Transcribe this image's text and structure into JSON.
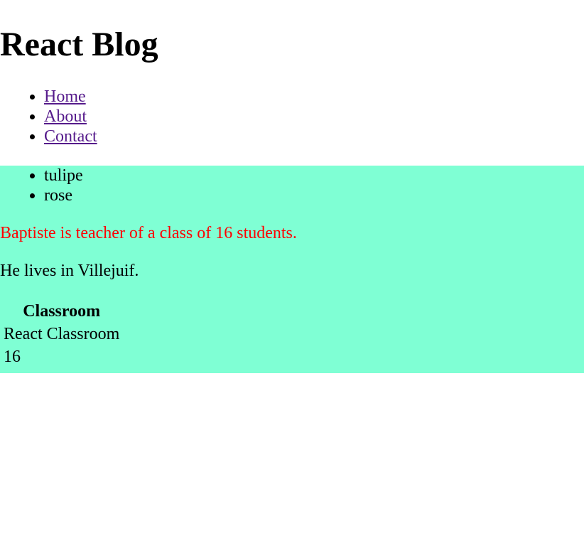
{
  "header": {
    "title": "React Blog"
  },
  "nav": {
    "items": [
      {
        "label": "Home"
      },
      {
        "label": "About"
      },
      {
        "label": "Contact"
      }
    ]
  },
  "content": {
    "background_color": "#7fffd4",
    "flowers": [
      "tulipe",
      "rose"
    ],
    "teacher_sentence": "Baptiste is teacher of a class of 16 students.",
    "teacher_sentence_color": "#ff0000",
    "lives_sentence": "He lives in Villejuif.",
    "table": {
      "header": "Classroom",
      "rows": [
        "React Classroom",
        "16"
      ]
    }
  },
  "colors": {
    "link": "#551a8b",
    "background": "#ffffff"
  }
}
